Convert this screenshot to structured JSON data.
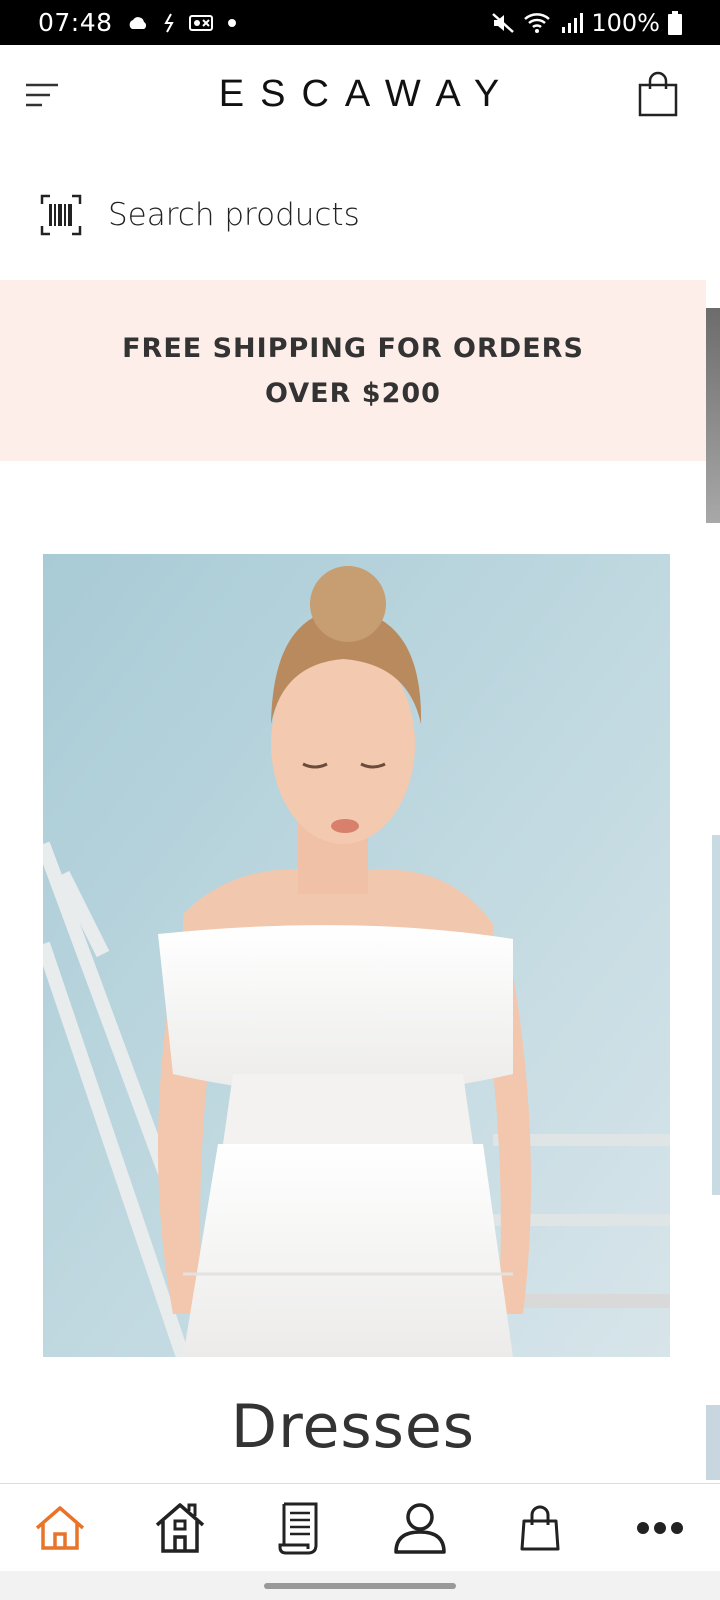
{
  "status_bar": {
    "time": "07:48",
    "battery": "100%",
    "icons_left": [
      "cloud-icon",
      "sync-icon",
      "voicemail-icon",
      "dot-icon"
    ],
    "icons_right": [
      "mute-icon",
      "wifi-icon",
      "signal-icon",
      "battery-icon"
    ]
  },
  "header": {
    "brand": "ESCAWAY",
    "menu_icon": "hamburger-icon",
    "cart_icon": "shopping-bag-icon"
  },
  "search": {
    "placeholder": "Search products",
    "icon": "barcode-scan-icon"
  },
  "promo": {
    "line1": "FREE SHIPPING FOR ORDERS",
    "line2": "OVER $200",
    "background": "#fdeee9"
  },
  "hero": {
    "category": "Dresses"
  },
  "bottom_nav": {
    "items": [
      {
        "icon": "home-icon",
        "active": true
      },
      {
        "icon": "store-icon",
        "active": false
      },
      {
        "icon": "receipt-icon",
        "active": false
      },
      {
        "icon": "account-icon",
        "active": false
      },
      {
        "icon": "bag-icon",
        "active": false
      },
      {
        "icon": "more-icon",
        "active": false
      }
    ],
    "active_color": "#e8742a"
  }
}
